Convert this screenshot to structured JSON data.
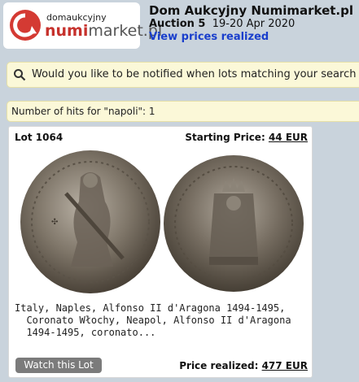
{
  "logo": {
    "small_text": "domaukcyjny",
    "brand_red": "numi",
    "brand_grey": "market.pl",
    "accent": "#d43a33"
  },
  "header": {
    "title": "Dom Aukcyjny Numimarket.pl",
    "auction_label": "Auction 5",
    "auction_dates": "19-20 Apr 2020",
    "view_prices_link": "View prices realized"
  },
  "notify": {
    "icon": "search-icon",
    "text": "Would you like to be notified when lots matching your search"
  },
  "hits": {
    "text": "Number of hits for \"napoli\": 1"
  },
  "lot": {
    "number": "Lot 1064",
    "starting_price_label": "Starting Price:",
    "starting_price_value": "44 EUR",
    "description_lines": [
      "Italy, Naples, Alfonso II d'Aragona 1494-1495,",
      "  Coronato Włochy, Neapol, Alfonso II d'Aragona",
      "  1494-1495, coronato..."
    ],
    "watch_button": "Watch this Lot",
    "price_realized_label": "Price realized:",
    "price_realized_value": "477 EUR"
  }
}
